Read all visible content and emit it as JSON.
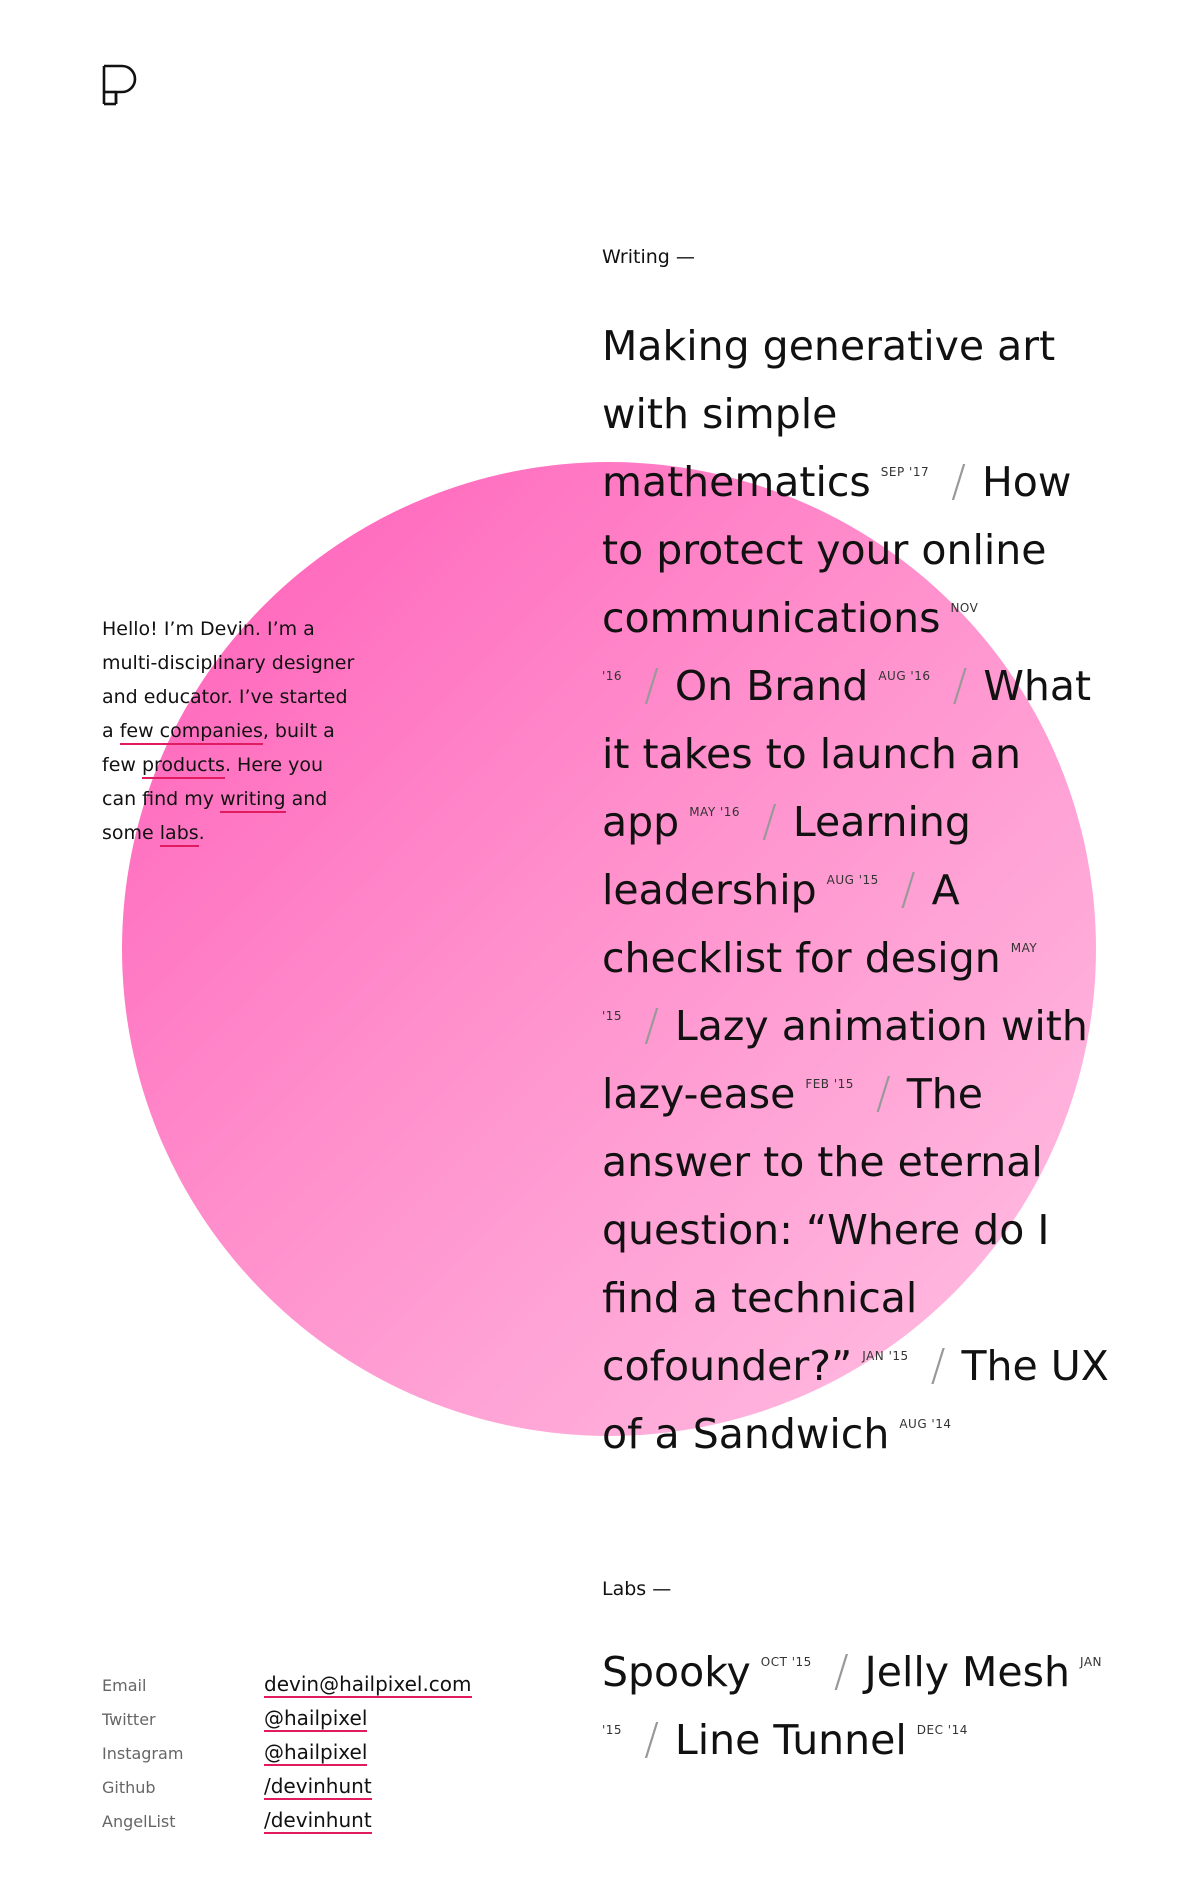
{
  "intro": {
    "t1": "Hello! I’m Devin. I’m a multi-disciplinary designer and educator. I’ve started a ",
    "few_companies": "few companies",
    "t2": ", built a few ",
    "products": "products",
    "t3": ". Here you can find my ",
    "writing": "writing",
    "t4": " and some ",
    "labs": "labs",
    "t5": "."
  },
  "writing": {
    "label": "Writing —",
    "items": [
      {
        "title": "Making generative art with simple mathematics",
        "date": "SEP '17"
      },
      {
        "title": "How to protect your online communications",
        "date": "NOV '16"
      },
      {
        "title": "On Brand",
        "date": "AUG '16"
      },
      {
        "title": "What it takes to launch an app",
        "date": "MAY '16"
      },
      {
        "title": "Learning leadership",
        "date": "AUG '15"
      },
      {
        "title": "A checklist for design",
        "date": "MAY '15"
      },
      {
        "title": "Lazy animation with lazy-ease",
        "date": "FEB '15"
      },
      {
        "title": "The answer to the eternal question: “Where do I find a technical cofounder?”",
        "date": "JAN '15"
      },
      {
        "title": "The UX of a Sandwich",
        "date": "AUG '14"
      }
    ],
    "separator": "/"
  },
  "labs": {
    "label": "Labs —",
    "items": [
      {
        "title": "Spooky",
        "date": "OCT '15"
      },
      {
        "title": "Jelly Mesh",
        "date": "JAN '15"
      },
      {
        "title": "Line Tunnel",
        "date": "DEC '14"
      }
    ],
    "separator": "/"
  },
  "contact": [
    {
      "key": "Email",
      "value": "devin@hailpixel.com"
    },
    {
      "key": "Twitter",
      "value": "@hailpixel"
    },
    {
      "key": "Instagram",
      "value": "@hailpixel"
    },
    {
      "key": "Github",
      "value": "/devinhunt"
    },
    {
      "key": "AngelList",
      "value": "/devinhunt"
    }
  ],
  "colors": {
    "accent_underline": "#e01b5f",
    "circle_start": "#ff5cb8",
    "circle_end": "#ffc2e4"
  },
  "icons": {
    "logo": "dh-monogram-logo"
  }
}
